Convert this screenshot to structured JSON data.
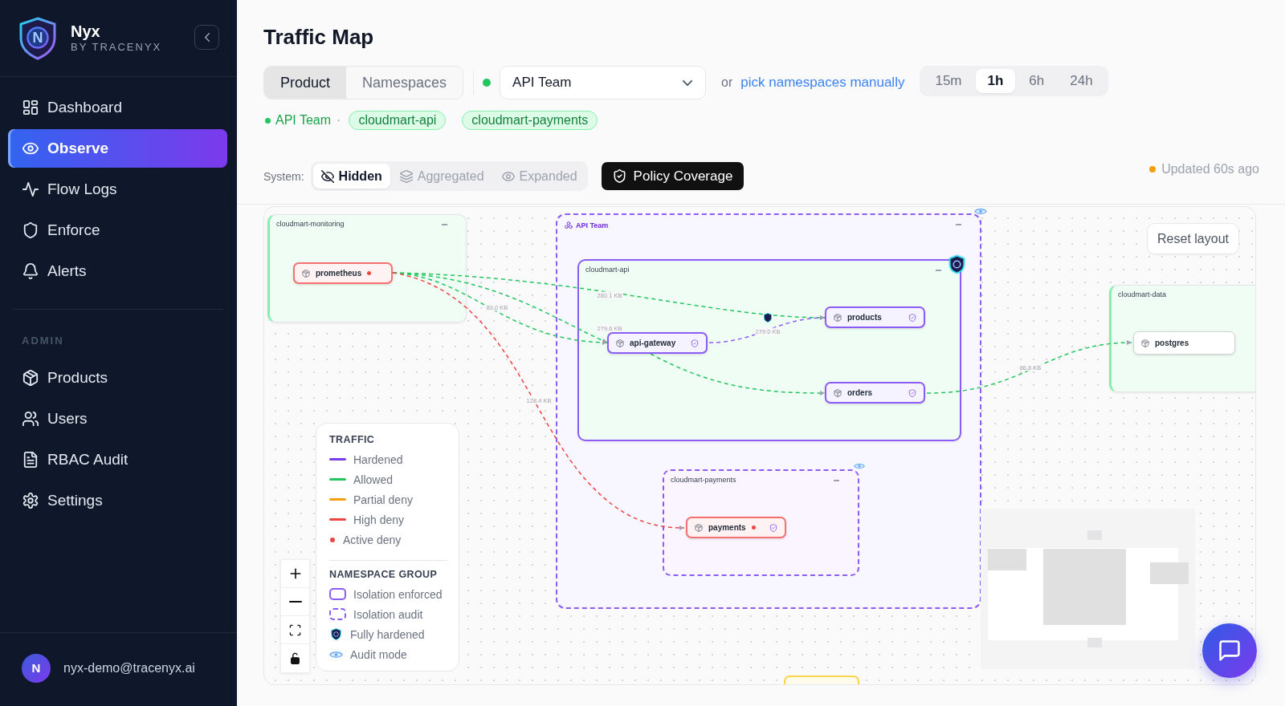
{
  "sidebar": {
    "brand": {
      "mark": "N",
      "name": "Nyx",
      "tagline": "BY TRACENYX"
    },
    "nav": [
      {
        "label": "Dashboard",
        "selected": false
      },
      {
        "label": "Observe",
        "selected": true
      },
      {
        "label": "Flow Logs",
        "selected": false
      },
      {
        "label": "Enforce",
        "selected": false
      },
      {
        "label": "Alerts",
        "selected": false
      }
    ],
    "admin_title": "ADMIN",
    "admin_nav": [
      {
        "label": "Products",
        "selected": false
      },
      {
        "label": "Users",
        "selected": false
      },
      {
        "label": "RBAC Audit",
        "selected": false
      },
      {
        "label": "Settings",
        "selected": false
      }
    ],
    "user": {
      "initial": "N",
      "email": "nyx-demo@tracenyx.ai"
    }
  },
  "header": {
    "title": "Traffic Map",
    "scope_tabs": [
      {
        "label": "Product",
        "selected": true
      },
      {
        "label": "Namespaces",
        "selected": false
      }
    ],
    "product_select": {
      "value": "API Team"
    },
    "or_text": "or",
    "manual_link": "pick namespaces manually",
    "time_ranges": [
      {
        "label": "15m",
        "selected": false
      },
      {
        "label": "1h",
        "selected": true
      },
      {
        "label": "6h",
        "selected": false
      },
      {
        "label": "24h",
        "selected": false
      }
    ],
    "scope_summary": {
      "product": "API Team",
      "separator": "·",
      "namespaces": [
        "cloudmart-api",
        "cloudmart-payments"
      ]
    },
    "system_label": "System:",
    "system_modes": [
      {
        "label": "Hidden",
        "selected": true
      },
      {
        "label": "Aggregated",
        "selected": false
      },
      {
        "label": "Expanded",
        "selected": false
      }
    ],
    "policy_button": "Policy Coverage",
    "updated": "Updated 60s ago"
  },
  "canvas": {
    "reset_button": "Reset layout",
    "groups": [
      {
        "kind": "namespace",
        "title": "cloudmart-monitoring",
        "nodes": [
          {
            "name": "prometheus",
            "kind": "deny"
          }
        ]
      },
      {
        "kind": "audit_product",
        "title": "API Team",
        "children": [
          {
            "kind": "hardened_namespace",
            "title": "cloudmart-api",
            "nodes": [
              {
                "name": "products",
                "kind": "hardened"
              },
              {
                "name": "api-gateway",
                "kind": "hardened"
              },
              {
                "name": "orders",
                "kind": "hardened"
              }
            ]
          },
          {
            "kind": "audit_namespace",
            "title": "cloudmart-payments",
            "nodes": [
              {
                "name": "payments",
                "kind": "hardened_deny"
              }
            ]
          }
        ]
      },
      {
        "kind": "namespace",
        "title": "cloudmart-data",
        "nodes": [
          {
            "name": "postgres",
            "kind": "plain"
          }
        ]
      }
    ],
    "edges": [
      {
        "kind": "allowed",
        "label": "280.1 KB"
      },
      {
        "kind": "allowed",
        "label": "279.6 KB"
      },
      {
        "kind": "allowed",
        "label": "83.0 KB"
      },
      {
        "kind": "high_deny",
        "label": "128.4 KB"
      },
      {
        "kind": "hardened",
        "label": "279.0 KB"
      },
      {
        "kind": "allowed"
      },
      {
        "kind": "allowed",
        "label": "86.8 KB"
      }
    ],
    "legend": {
      "traffic_title": "TRAFFIC",
      "traffic": [
        {
          "kind": "line",
          "color": "#7c3aed",
          "label": "Hardened"
        },
        {
          "kind": "line",
          "color": "#22c55e",
          "label": "Allowed"
        },
        {
          "kind": "line",
          "color": "#f59e0b",
          "label": "Partial deny"
        },
        {
          "kind": "line",
          "color": "#ef4444",
          "label": "High deny"
        },
        {
          "kind": "dot",
          "color": "#ef4444",
          "label": "Active deny"
        }
      ],
      "group_title": "NAMESPACE GROUP",
      "groups": [
        {
          "kind": "solid",
          "label": "Isolation enforced"
        },
        {
          "kind": "dashed",
          "label": "Isolation audit"
        },
        {
          "kind": "shield",
          "label": "Fully hardened"
        },
        {
          "kind": "eye",
          "label": "Audit mode"
        }
      ]
    }
  }
}
